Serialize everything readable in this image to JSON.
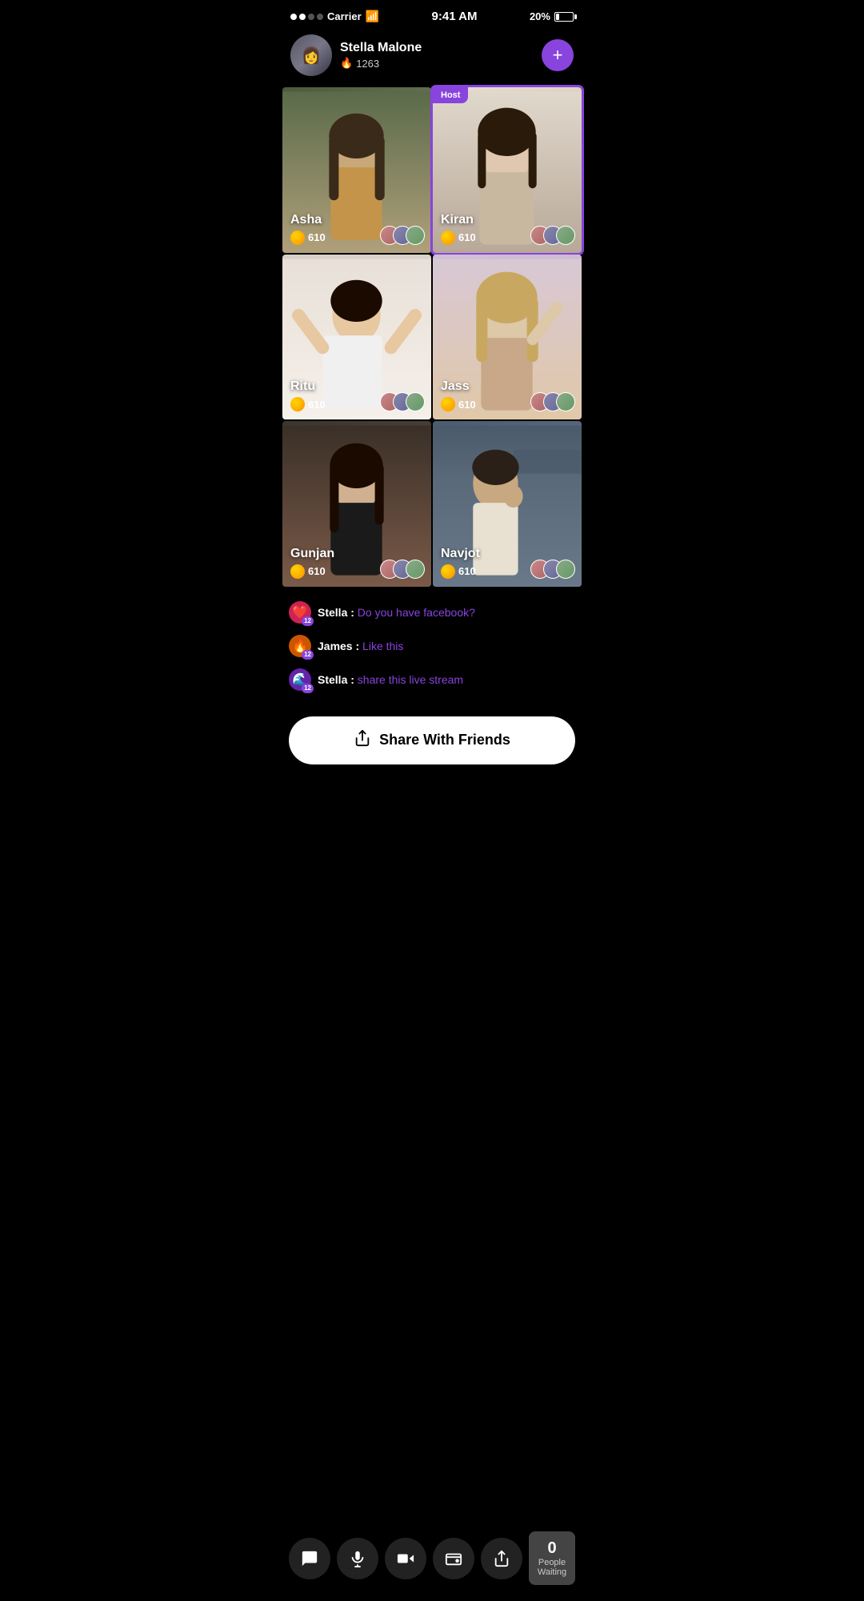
{
  "statusBar": {
    "carrier": "Carrier",
    "time": "9:41 AM",
    "battery": "20%"
  },
  "profile": {
    "name": "Stella Malone",
    "score": "1263",
    "addLabel": "+"
  },
  "streamers": [
    {
      "id": "asha",
      "name": "Asha",
      "coins": "610",
      "isHost": false,
      "bgClass": "bg-asha"
    },
    {
      "id": "kiran",
      "name": "Kiran",
      "coins": "610",
      "isHost": true,
      "bgClass": "bg-kiran"
    },
    {
      "id": "ritu",
      "name": "Ritu",
      "coins": "610",
      "isHost": false,
      "bgClass": "bg-ritu"
    },
    {
      "id": "jass",
      "name": "Jass",
      "coins": "610",
      "isHost": false,
      "bgClass": "bg-jass"
    },
    {
      "id": "gunjan",
      "name": "Gunjan",
      "coins": "610",
      "isHost": false,
      "bgClass": "bg-gunjan"
    },
    {
      "id": "navjot",
      "name": "Navjot",
      "coins": "610",
      "isHost": false,
      "bgClass": "bg-navjot"
    }
  ],
  "hostLabel": "Host",
  "chat": {
    "messages": [
      {
        "id": "msg1",
        "user": "Stella",
        "text": "Do you have facebook?",
        "icon": "❤️",
        "level": "12"
      },
      {
        "id": "msg2",
        "user": "James",
        "text": "Like this",
        "icon": "🔥",
        "level": "12"
      },
      {
        "id": "msg3",
        "user": "Stella",
        "text": "share this live stream",
        "icon": "🌊",
        "level": "12"
      }
    ]
  },
  "shareButton": {
    "label": "Share With Friends"
  },
  "toolbar": {
    "chat_icon": "💬",
    "mic_icon": "🎤",
    "video_icon": "🎥",
    "wallet_icon": "👛",
    "share_icon": "⬆️"
  },
  "waiting": {
    "count": "0",
    "label": "People Waiting"
  }
}
